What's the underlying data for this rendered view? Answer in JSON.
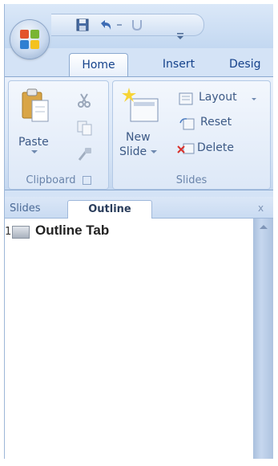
{
  "ribbon": {
    "tabs": [
      {
        "label": "Home",
        "active": true
      },
      {
        "label": "Insert",
        "active": false
      },
      {
        "label": "Desig",
        "active": false
      }
    ],
    "clipboard": {
      "paste_label": "Paste",
      "group_label": "Clipboard"
    },
    "slides": {
      "new_slide_line1": "New",
      "new_slide_line2": "Slide",
      "layout_label": "Layout",
      "reset_label": "Reset",
      "delete_label": "Delete",
      "group_label": "Slides"
    }
  },
  "panel": {
    "tabs": [
      {
        "label": "Slides",
        "active": false
      },
      {
        "label": "Outline",
        "active": true
      }
    ],
    "close_glyph": "x"
  },
  "outline": {
    "slides": [
      {
        "number": "1",
        "title": "Outline Tab"
      }
    ]
  },
  "icons": {
    "office_button": "office-logo-icon",
    "save": "save-icon",
    "undo": "undo-icon",
    "redo": "redo-icon",
    "qat_menu": "qat-customize-icon",
    "paste": "paste-icon",
    "cut": "cut-icon",
    "copy": "copy-icon",
    "format_painter": "format-painter-icon",
    "new_slide": "new-slide-icon",
    "layout": "layout-icon",
    "reset": "reset-icon",
    "delete": "delete-icon"
  },
  "colors": {
    "accent": "#15428b",
    "ribbon_bg": "#d5e3f5",
    "label": "#6b85ab"
  }
}
